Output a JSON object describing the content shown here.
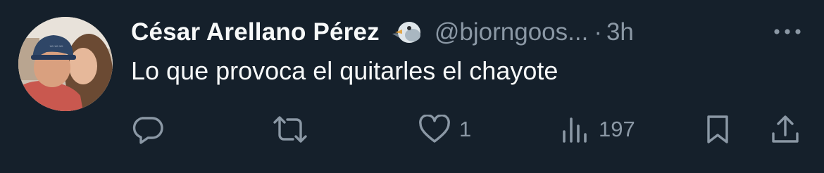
{
  "tweet": {
    "author_name": "César Arellano Pérez",
    "author_emoji": "bird-emoji",
    "handle": "@bjorngoos...",
    "separator": "·",
    "time": "3h",
    "text": "Lo que provoca el quitarles el chayote"
  },
  "actions": {
    "reply": {
      "icon": "reply-icon",
      "count": ""
    },
    "retweet": {
      "icon": "retweet-icon",
      "count": ""
    },
    "like": {
      "icon": "heart-icon",
      "count": "1"
    },
    "views": {
      "icon": "views-icon",
      "count": "197"
    },
    "bookmark": {
      "icon": "bookmark-icon"
    },
    "share": {
      "icon": "share-icon"
    }
  },
  "colors": {
    "background": "#15202b",
    "primary_text": "#f7f9f9",
    "secondary_text": "#8b98a5"
  }
}
